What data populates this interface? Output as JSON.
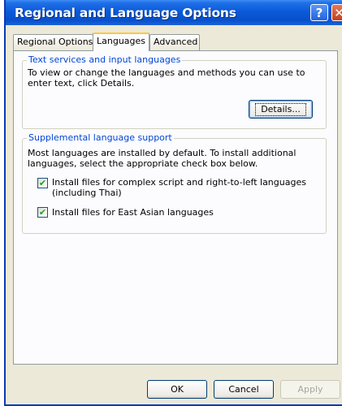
{
  "window": {
    "title": "Regional and Language Options"
  },
  "titlebar": {
    "help_glyph": "?",
    "close_glyph": "✕"
  },
  "tabs": [
    {
      "label": "Regional Options"
    },
    {
      "label": "Languages"
    },
    {
      "label": "Advanced"
    }
  ],
  "text_services": {
    "title": "Text services and input languages",
    "description": "To view or change the languages and methods you can use to enter text, click Details.",
    "details_button": "Details..."
  },
  "supplemental": {
    "title": "Supplemental language support",
    "description": "Most languages are installed by default. To install additional languages, select the appropriate check box below.",
    "complex_script_label": "Install files for complex script and right-to-left languages (including Thai)",
    "complex_script_checked": true,
    "east_asian_label": "Install files for East Asian languages",
    "east_asian_checked": true
  },
  "footer": {
    "ok": "OK",
    "cancel": "Cancel",
    "apply": "Apply"
  },
  "colors": {
    "titlebar": "#0b5ad9",
    "group_title": "#0046d5",
    "active_tab_accent": "#ffc83c",
    "checkmark": "#21a121"
  },
  "icons": {
    "check_glyph": "✔"
  }
}
